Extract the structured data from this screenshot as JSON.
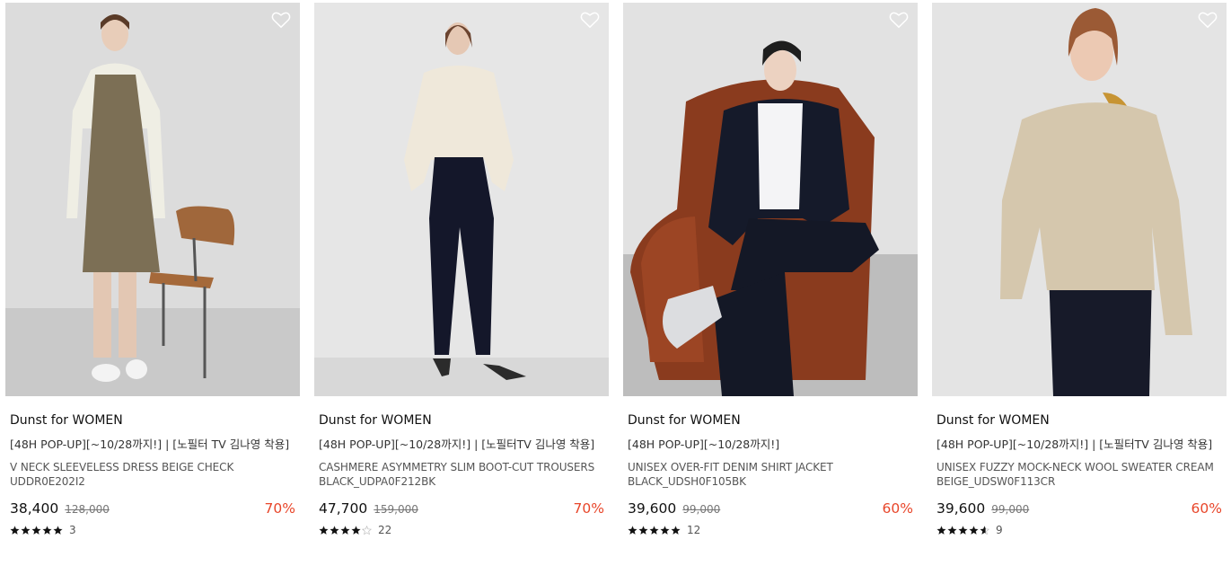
{
  "products": [
    {
      "brand": "Dunst for WOMEN",
      "promo": "[48H POP-UP][~10/28까지!] | [노필터 TV 김나영 착용]",
      "name": "V NECK SLEEVELESS DRESS BEIGE CHECK UDDR0E202I2",
      "price": "38,400",
      "original_price": "128,000",
      "discount": "70%",
      "rating": 5,
      "review_count": "3",
      "image_icon": "model-photo"
    },
    {
      "brand": "Dunst for WOMEN",
      "promo": "[48H POP-UP][~10/28까지!] | [노필터TV 김나영 착용]",
      "name": "CASHMERE ASYMMETRY SLIM BOOT-CUT TROUSERS BLACK_UDPA0F212BK",
      "price": "47,700",
      "original_price": "159,000",
      "discount": "70%",
      "rating": 4.1,
      "review_count": "22",
      "image_icon": "model-photo"
    },
    {
      "brand": "Dunst for WOMEN",
      "promo": "[48H POP-UP][~10/28까지!]",
      "name": "UNISEX OVER-FIT DENIM SHIRT JACKET BLACK_UDSH0F105BK",
      "price": "39,600",
      "original_price": "99,000",
      "discount": "60%",
      "rating": 5,
      "review_count": "12",
      "image_icon": "model-photo"
    },
    {
      "brand": "Dunst for WOMEN",
      "promo": "[48H POP-UP][~10/28까지!] | [노필터TV 김나영 착용]",
      "name": "UNISEX FUZZY MOCK-NECK WOOL SWEATER CREAM BEIGE_UDSW0F113CR",
      "price": "39,600",
      "original_price": "99,000",
      "discount": "60%",
      "rating": 4.6,
      "review_count": "9",
      "image_icon": "model-photo"
    }
  ],
  "colors": {
    "discount": "#e8462a",
    "text": "#111111",
    "muted": "#777777",
    "star": "#111111"
  },
  "icons": {
    "wishlist": "heart-outline-icon",
    "rating": "star-icon"
  }
}
